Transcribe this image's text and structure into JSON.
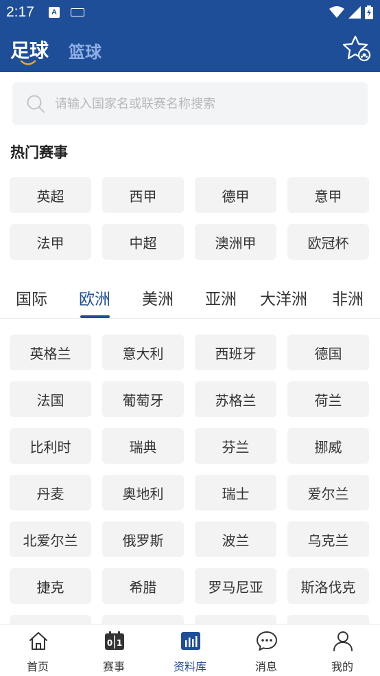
{
  "status_bar": {
    "time": "2:17",
    "a_icon_label": "A"
  },
  "top_tabs": {
    "football": "足球",
    "basketball": "篮球"
  },
  "search": {
    "placeholder": "请输入国家名或联赛名称搜索"
  },
  "hot": {
    "title": "热门赛事",
    "items": [
      "英超",
      "西甲",
      "德甲",
      "意甲",
      "法甲",
      "中超",
      "澳洲甲",
      "欧冠杯"
    ]
  },
  "regions": {
    "tabs": [
      "国际",
      "欧洲",
      "美洲",
      "亚洲",
      "大洋洲",
      "非洲"
    ],
    "active": "欧洲"
  },
  "countries": [
    "英格兰",
    "意大利",
    "西班牙",
    "德国",
    "法国",
    "葡萄牙",
    "苏格兰",
    "荷兰",
    "比利时",
    "瑞典",
    "芬兰",
    "挪威",
    "丹麦",
    "奥地利",
    "瑞士",
    "爱尔兰",
    "北爱尔兰",
    "俄罗斯",
    "波兰",
    "乌克兰",
    "捷克",
    "希腊",
    "罗马尼亚",
    "斯洛伐克"
  ],
  "bottom_nav": {
    "items": [
      {
        "label": "首页",
        "icon": "home-icon"
      },
      {
        "label": "赛事",
        "icon": "scoreboard-icon",
        "icon_text": "0 1"
      },
      {
        "label": "资料库",
        "icon": "chart-icon",
        "active": true
      },
      {
        "label": "消息",
        "icon": "chat-icon"
      },
      {
        "label": "我的",
        "icon": "person-icon"
      }
    ]
  },
  "colors": {
    "primary": "#1f4e99",
    "inactive_tab": "#8fb0e4",
    "chip_bg": "#f3f3f3"
  }
}
